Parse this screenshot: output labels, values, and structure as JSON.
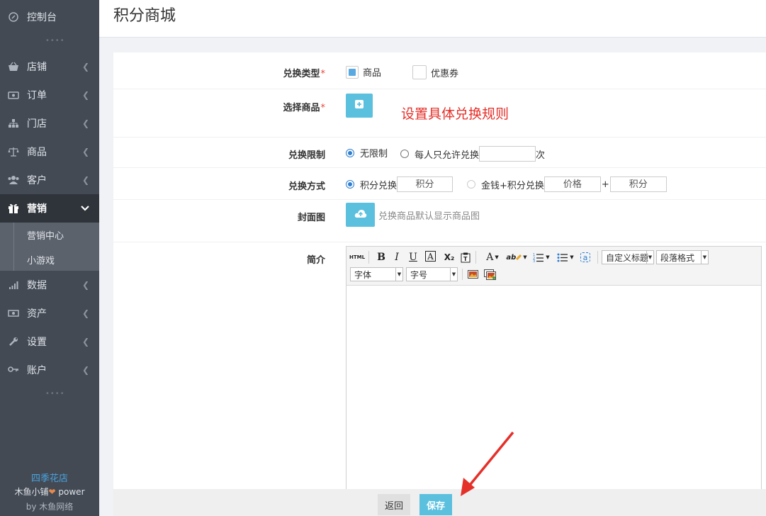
{
  "sidebar": {
    "dashboard": "控制台",
    "items": [
      {
        "label": "店铺",
        "icon": "shop-basket-icon"
      },
      {
        "label": "订单",
        "icon": "order-icon"
      },
      {
        "label": "门店",
        "icon": "store-sitemap-icon"
      },
      {
        "label": "商品",
        "icon": "balance-scale-icon"
      },
      {
        "label": "客户",
        "icon": "users-icon"
      },
      {
        "label": "营销",
        "icon": "gift-icon"
      },
      {
        "label": "数据",
        "icon": "bar-chart-icon"
      },
      {
        "label": "资产",
        "icon": "money-icon"
      },
      {
        "label": "设置",
        "icon": "wrench-icon"
      },
      {
        "label": "账户",
        "icon": "key-icon"
      }
    ],
    "submenu": [
      "营销中心",
      "小游戏"
    ],
    "footer": {
      "store": "四季花店",
      "brand": "木鱼小铺",
      "power": "power",
      "by_prefix": "by",
      "by_name": "木鱼网络"
    }
  },
  "header": {
    "title": "积分商城"
  },
  "form": {
    "exchange_type": {
      "label": "兑换类型",
      "options": [
        "商品",
        "优惠券"
      ]
    },
    "select_goods": {
      "label": "选择商品",
      "annotation": "设置具体兑换规则"
    },
    "limit": {
      "label": "兑换限制",
      "option_none": "无限制",
      "option_per_person": "每人只允许兑换",
      "suffix": "次",
      "value": ""
    },
    "method": {
      "label": "兑换方式",
      "option_points": "积分兑换",
      "points_placeholder": "积分",
      "option_money": "金钱+积分兑换",
      "price_placeholder": "价格",
      "plus": "+",
      "points2_placeholder": "积分"
    },
    "cover": {
      "label": "封面图",
      "hint": "兑换商品默认显示商品图"
    },
    "intro": {
      "label": "简介",
      "toolbar": {
        "html": "HTML",
        "bold": "B",
        "italic": "I",
        "underline": "U",
        "border_a": "A",
        "sub": "X₂",
        "fontcolor": "A",
        "custom_title": "自定义标题",
        "paragraph": "段落格式",
        "font": "字体",
        "size": "字号",
        "lookup": "a",
        "abc": "ab"
      }
    }
  },
  "actions": {
    "back": "返回",
    "save": "保存"
  },
  "colors": {
    "sidebar": "#434a54",
    "accent": "#5bc0de",
    "annotation": "#e5302a",
    "store_link": "#4aa3df"
  }
}
